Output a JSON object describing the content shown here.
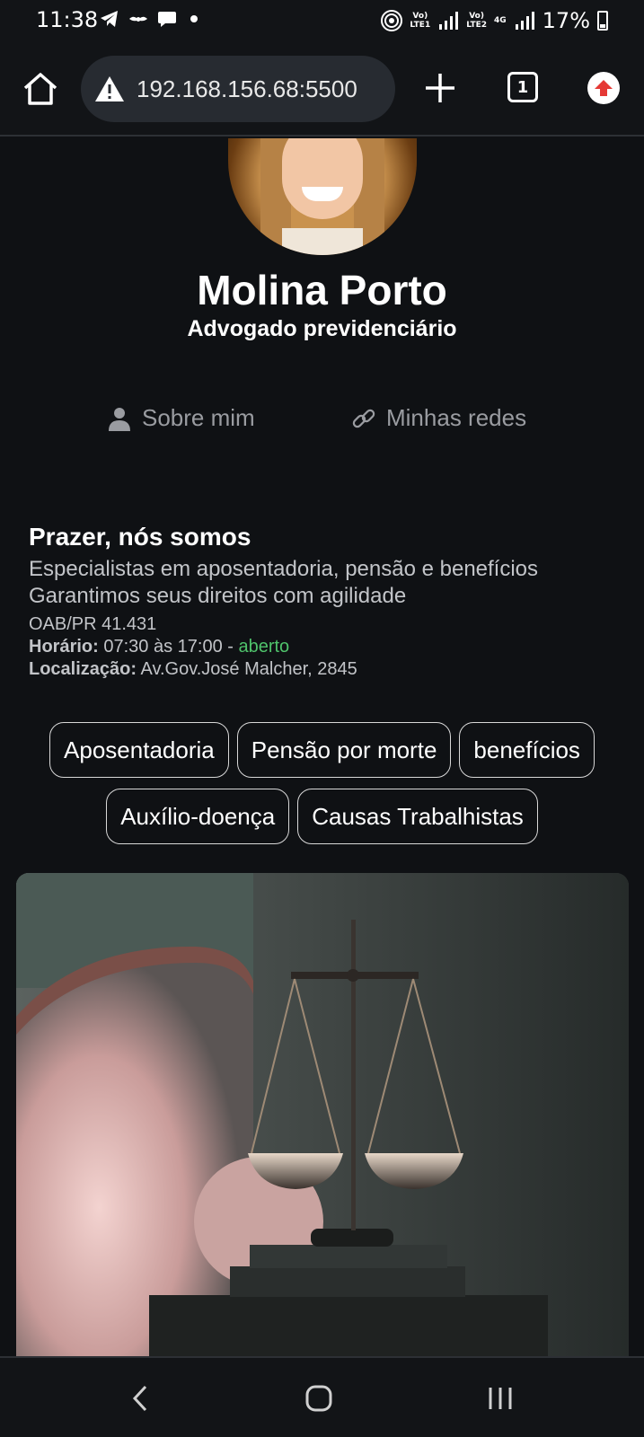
{
  "status_bar": {
    "time": "11:38",
    "net1": [
      "Vo)",
      "LTE1"
    ],
    "net2": [
      "Vo)",
      "LTE2"
    ],
    "net2_gen": "4G",
    "battery": "17%"
  },
  "browser": {
    "url": "192.168.156.68:5500",
    "tab_count": "1",
    "accent_update": "#e53935"
  },
  "profile": {
    "name": "Molina Porto",
    "role": "Advogado previdenciário"
  },
  "tabs": [
    {
      "label": "Sobre mim",
      "icon": "person-icon"
    },
    {
      "label": "Minhas redes",
      "icon": "link-icon"
    }
  ],
  "about": {
    "title": "Prazer, nós somos",
    "line1": "Especialistas em aposentadoria, pensão e benefícios",
    "line2": "Garantimos seus direitos com agilidade",
    "oab": "OAB/PR 41.431",
    "hours_label": "Horário:",
    "hours_value": "07:30 às 17:00 - ",
    "hours_status": "aberto",
    "location_label": "Localização:",
    "location_value": "Av.Gov.José Malcher, 2845"
  },
  "chips": {
    "row1": [
      "Aposentadoria",
      "Pensão por morte",
      "benefícios"
    ],
    "row2": [
      "Auxílio-doença",
      "Causas Trabalhistas"
    ]
  },
  "colors": {
    "background": "#0f1114",
    "open_status": "#4fc36b"
  }
}
